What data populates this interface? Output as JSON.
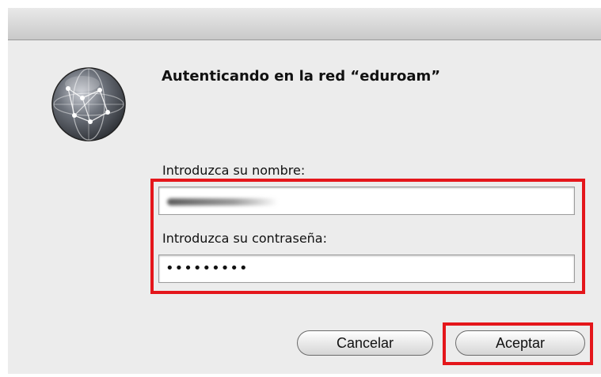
{
  "dialog": {
    "title": "Autenticando en la red “eduroam”",
    "icon": "network-globe-icon",
    "username_label": "Introduzca su nombre:",
    "username_value": "",
    "password_label": "Introduzca su contraseña:",
    "password_value": "•••••••••",
    "cancel_label": "Cancelar",
    "accept_label": "Aceptar"
  },
  "colors": {
    "highlight": "#e4161b",
    "dialog_bg": "#ececec"
  }
}
